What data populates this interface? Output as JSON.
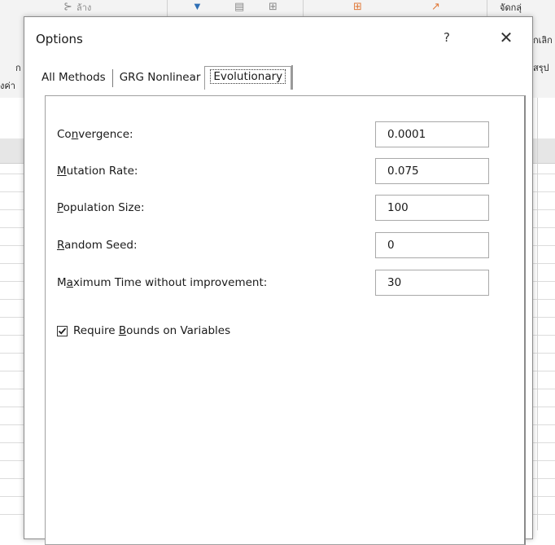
{
  "dialog": {
    "title": "Options",
    "help_label": "?",
    "close_label": "✕"
  },
  "tabs": [
    {
      "label": "All Methods",
      "active": false
    },
    {
      "label": "GRG Nonlinear",
      "active": false
    },
    {
      "label": "Evolutionary",
      "active": true
    }
  ],
  "fields": {
    "convergence": {
      "label_pre": "Co",
      "label_key": "n",
      "label_post": "vergence:",
      "value": "0.0001"
    },
    "mutation_rate": {
      "label_pre": "",
      "label_key": "M",
      "label_post": "utation Rate:",
      "value": "0.075"
    },
    "population_size": {
      "label_pre": "",
      "label_key": "P",
      "label_post": "opulation Size:",
      "value": "100"
    },
    "random_seed": {
      "label_pre": "",
      "label_key": "R",
      "label_post": "andom Seed:",
      "value": "0"
    },
    "max_time": {
      "label_pre": "M",
      "label_key": "a",
      "label_post": "ximum Time without improvement:",
      "value": "30"
    }
  },
  "require_bounds": {
    "label_pre": "Require ",
    "label_key": "B",
    "label_post": "ounds on Variables",
    "checked": true
  },
  "background": {
    "ribbon_text_left": "ล้าง",
    "ribbon_text_right_1": "จัดกลุ่",
    "ribbon_text_right_2": "กเลิก",
    "ribbon_text_right_3": "สรุป",
    "left_text_1": "ก",
    "left_text_2": "งค่า"
  },
  "colors": {
    "dialog_bg": "#ffffff",
    "border": "#a0a0a0",
    "ribbon_bg": "#f3f3f3"
  }
}
